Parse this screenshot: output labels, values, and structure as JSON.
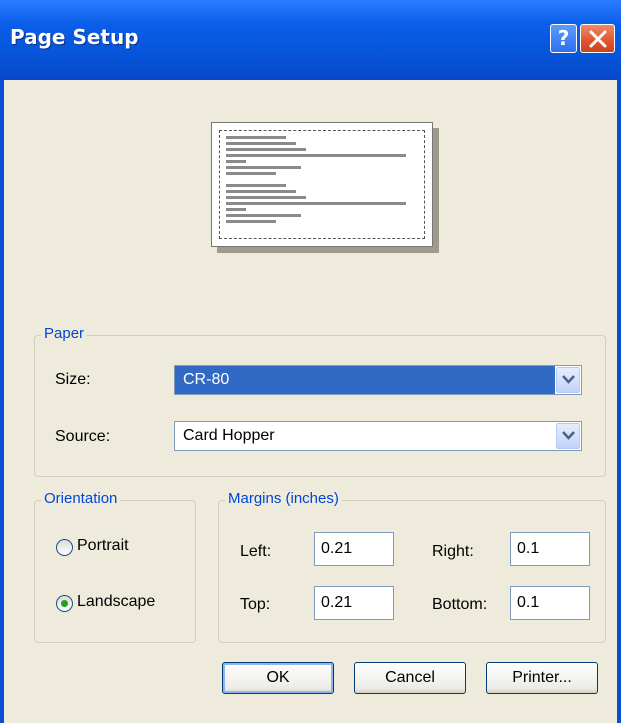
{
  "window": {
    "title": "Page Setup",
    "help_label": "?"
  },
  "paper": {
    "legend": "Paper",
    "size_label": "Size:",
    "size_value": "CR-80",
    "source_label": "Source:",
    "source_value": "Card Hopper"
  },
  "orientation": {
    "legend": "Orientation",
    "portrait_label": "Portrait",
    "landscape_label": "Landscape",
    "selected": "Landscape"
  },
  "margins": {
    "legend": "Margins (inches)",
    "left_label": "Left:",
    "left_value": "0.21",
    "right_label": "Right:",
    "right_value": "0.1",
    "top_label": "Top:",
    "top_value": "0.21",
    "bottom_label": "Bottom:",
    "bottom_value": "0.1"
  },
  "buttons": {
    "ok": "OK",
    "cancel": "Cancel",
    "printer": "Printer..."
  },
  "colors": {
    "title_bar": "#0a5ee8",
    "dialog_bg": "#efebdc",
    "group_legend": "#0046d5",
    "selection": "#316ac5"
  }
}
